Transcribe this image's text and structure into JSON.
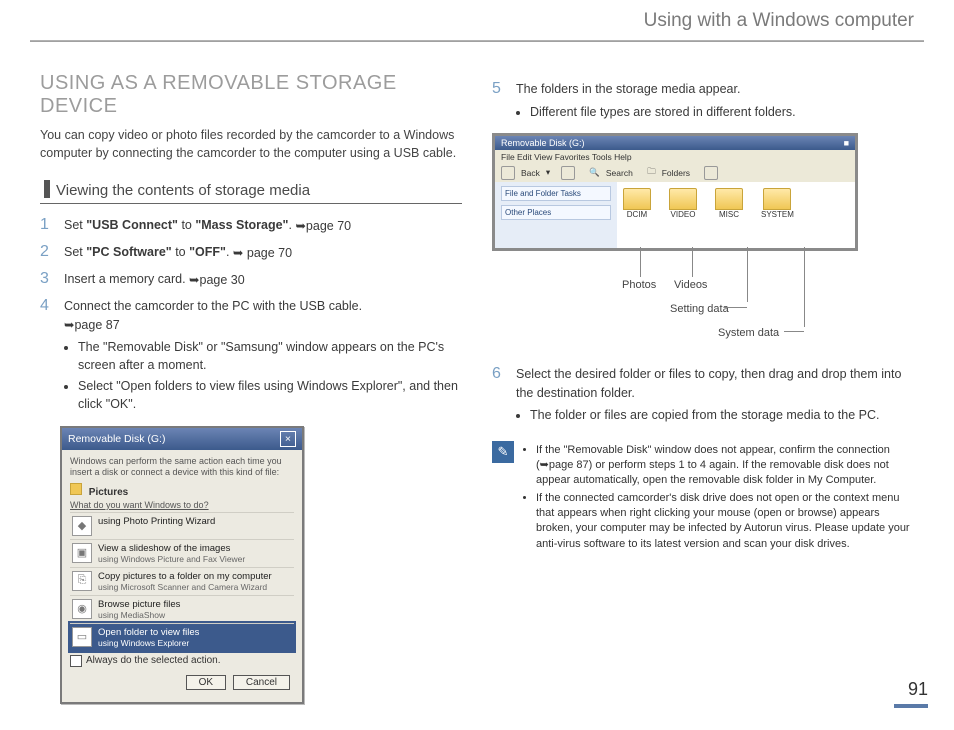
{
  "header": {
    "chapter": "Using with a Windows computer"
  },
  "left": {
    "title": "USING AS A REMOVABLE STORAGE DEVICE",
    "intro": "You can copy video or photo files recorded by the camcorder to a Windows computer by connecting the camcorder to the computer using a USB cable.",
    "subhead": "Viewing the contents of storage media",
    "steps": {
      "s1": {
        "num": "1",
        "text_a": "Set ",
        "bold1": "\"USB Connect\"",
        "text_b": " to ",
        "bold2": "\"Mass Storage\"",
        "text_c": ". ",
        "ref": "➥page 70"
      },
      "s2": {
        "num": "2",
        "text_a": "Set ",
        "bold1": "\"PC Software\"",
        "text_b": " to ",
        "bold2": "\"OFF\"",
        "text_c": ". ",
        "ref": "➥ page 70"
      },
      "s3": {
        "num": "3",
        "text": "Insert a memory card. ",
        "ref": "➥page 30"
      },
      "s4": {
        "num": "4",
        "text": "Connect the camcorder to the PC with the USB cable.",
        "ref": "➥page 87",
        "bul1": "The \"Removable Disk\" or \"Samsung\" window appears on the PC's screen after a moment.",
        "bul2": "Select \"Open folders to view files using Windows Explorer\", and then click \"OK\"."
      }
    },
    "dialog": {
      "title": "Removable Disk (G:)",
      "lead": "Windows can perform the same action each time you insert a disk or connect a device with this kind of file:",
      "section_icon_label": "Pictures",
      "prompt": "What do you want Windows to do?",
      "opt1_t": "using Photo Printing Wizard",
      "opt1_s": "",
      "opt2_t": "View a slideshow of the images",
      "opt2_s": "using Windows Picture and Fax Viewer",
      "opt3_t": "Copy pictures to a folder on my computer",
      "opt3_s": "using Microsoft Scanner and Camera Wizard",
      "opt4_t": "Browse picture files",
      "opt4_s": "using MediaShow",
      "opt5_t": "Open folder to view files",
      "opt5_s": "using Windows Explorer",
      "always": "Always do the selected action.",
      "ok": "OK",
      "cancel": "Cancel"
    }
  },
  "right": {
    "s5": {
      "num": "5",
      "text": "The folders in the storage media appear.",
      "bul1": "Different file types are stored in different folders."
    },
    "explorer": {
      "title": "Removable Disk (G:)",
      "menu": "File  Edit  View  Favorites  Tools  Help",
      "back": "Back",
      "search": "Search",
      "folders": "Folders",
      "side1": "File and Folder Tasks",
      "side2": "Other Places",
      "folders_list": {
        "f1": "DCIM",
        "f2": "VIDEO",
        "f3": "MISC",
        "f4": "SYSTEM"
      }
    },
    "callouts": {
      "photos": "Photos",
      "videos": "Videos",
      "setting": "Setting data",
      "system": "System data"
    },
    "s6": {
      "num": "6",
      "text": "Select the desired folder or files to copy, then drag and drop them into the destination folder.",
      "bul1": "The folder or files are copied from the storage media to the PC."
    },
    "note": {
      "n1": "If the \"Removable Disk\" window does not appear, confirm the connection (➥page 87) or perform steps 1 to 4 again. If the removable disk does not appear automatically, open the removable disk folder in My Computer.",
      "n2": "If the connected camcorder's disk drive does not open or the context menu that appears when right clicking your mouse (open or browse) appears broken, your computer may be infected by Autorun virus. Please update your anti-virus software to its latest version and scan your disk drives."
    }
  },
  "page_number": "91"
}
